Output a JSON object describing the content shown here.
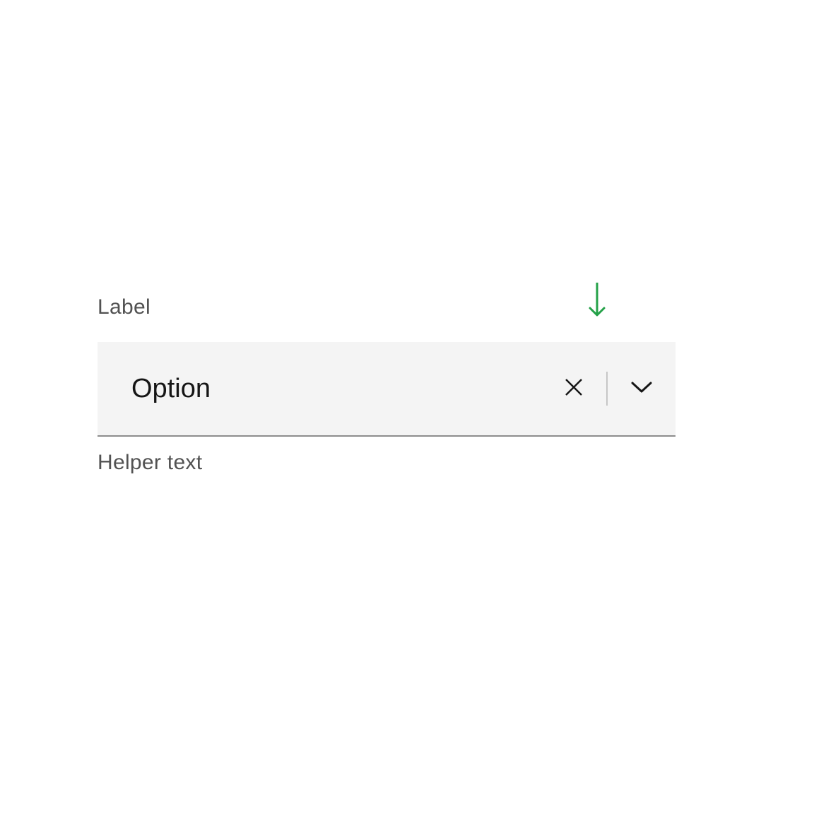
{
  "dropdown": {
    "label": "Label",
    "value": "Option",
    "helper_text": "Helper text"
  },
  "colors": {
    "accent_green": "#24a148",
    "text_primary": "#161616",
    "text_secondary": "#525252",
    "field_bg": "#f4f4f4",
    "border": "#8d8d8d"
  }
}
